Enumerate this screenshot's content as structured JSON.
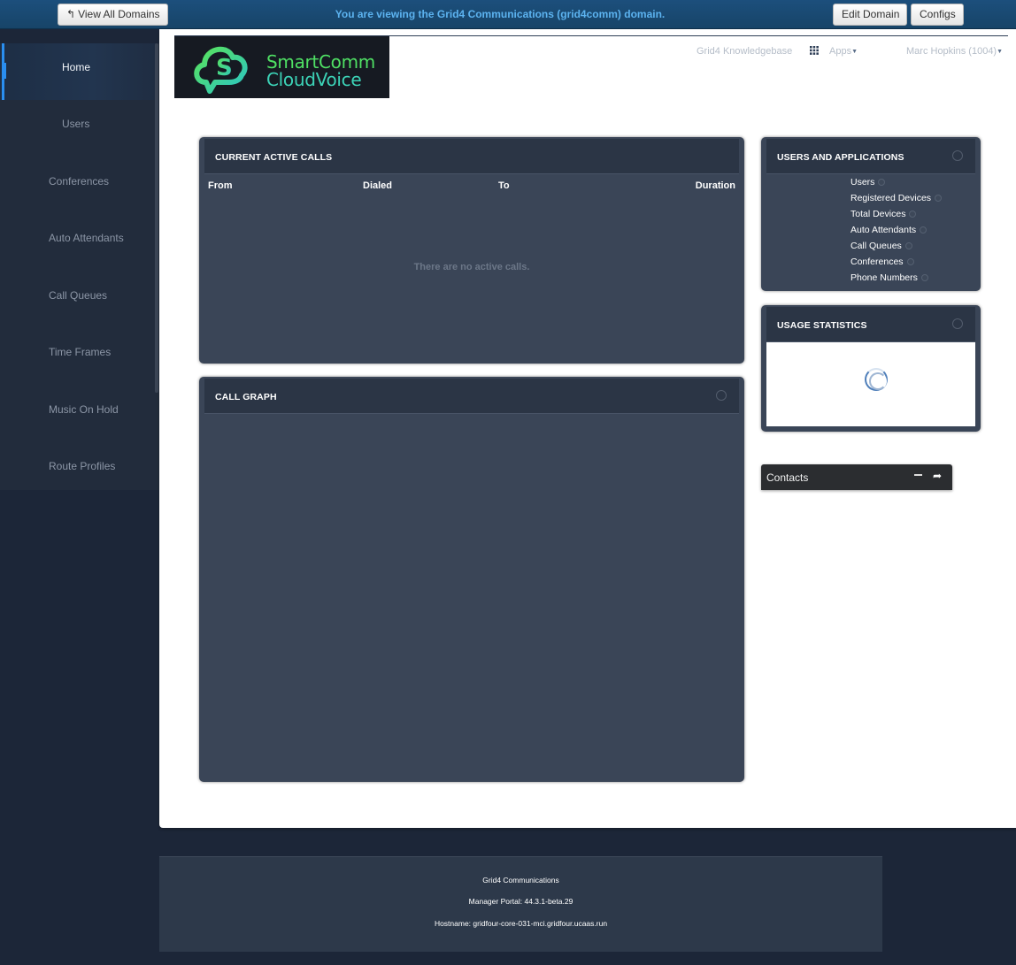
{
  "topbar": {
    "view_all_domains": "View All Domains",
    "domain_notice": "You are viewing the Grid4 Communications (grid4comm) domain.",
    "edit_domain": "Edit Domain",
    "configs": "Configs"
  },
  "sidebar": {
    "items": [
      {
        "label": "Home",
        "active": true
      },
      {
        "label": "Users"
      },
      {
        "label": "Conferences"
      },
      {
        "label": "Auto Attendants"
      },
      {
        "label": "Call Queues"
      },
      {
        "label": "Time Frames"
      },
      {
        "label": "Music On Hold"
      },
      {
        "label": "Route Profiles"
      }
    ]
  },
  "header": {
    "logo_line1": "SmartComm",
    "logo_line2": "CloudVoice",
    "knowledgebase": "Grid4 Knowledgebase",
    "apps": "Apps",
    "user": "Marc Hopkins (1004)"
  },
  "active_calls": {
    "title": "CURRENT ACTIVE CALLS",
    "columns": [
      "From",
      "Dialed",
      "To",
      "Duration"
    ],
    "empty_message": "There are no active calls."
  },
  "call_graph": {
    "title": "CALL GRAPH"
  },
  "users_apps": {
    "title": "USERS AND APPLICATIONS",
    "rows": [
      "Users",
      "Registered Devices",
      "Total Devices",
      "Auto Attendants",
      "Call Queues",
      "Conferences",
      "Phone Numbers"
    ]
  },
  "usage": {
    "title": "USAGE STATISTICS"
  },
  "contacts": {
    "label": "Contacts"
  },
  "footer": {
    "company": "Grid4 Communications",
    "portal_version": "Manager Portal: 44.3.1-beta.29",
    "hostname": "Hostname: gridfour-core-031-mci.gridfour.ucaas.run"
  },
  "colors": {
    "accent": "#2a8ef0",
    "notice": "#5cb3f0",
    "card": "#3a4557"
  }
}
